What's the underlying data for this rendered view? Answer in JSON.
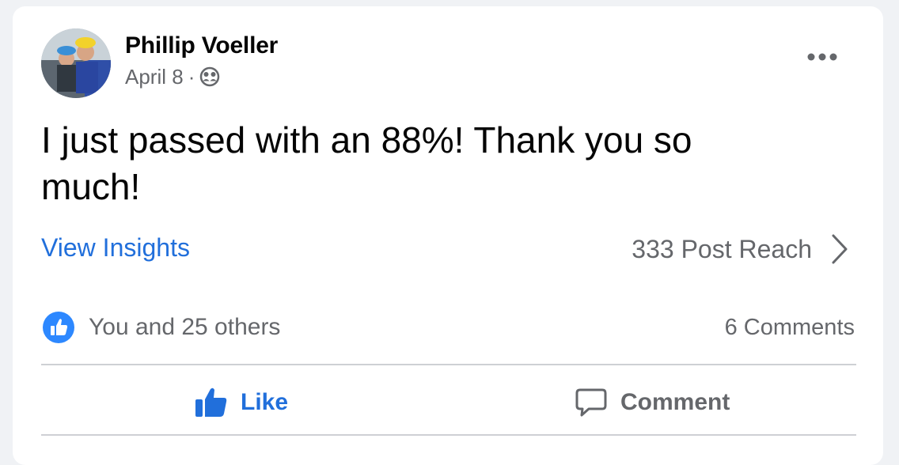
{
  "post": {
    "author": "Phillip Voeller",
    "date": "April 8",
    "separator": "·",
    "audience_icon": "friends-icon",
    "text": "I just passed with an 88%! Thank you so much!",
    "more_icon": "more-options-icon"
  },
  "insights": {
    "link_label": "View Insights",
    "reach_label": "333 Post Reach"
  },
  "engagement": {
    "reactions_label": "You and 25 others",
    "comments_label": "6 Comments"
  },
  "actions": {
    "like_label": "Like",
    "comment_label": "Comment"
  },
  "colors": {
    "accent_blue": "#216fdb",
    "secondary_text": "#65676b",
    "primary_text": "#050505",
    "card_bg": "#ffffff",
    "page_bg": "#f0f2f5"
  }
}
